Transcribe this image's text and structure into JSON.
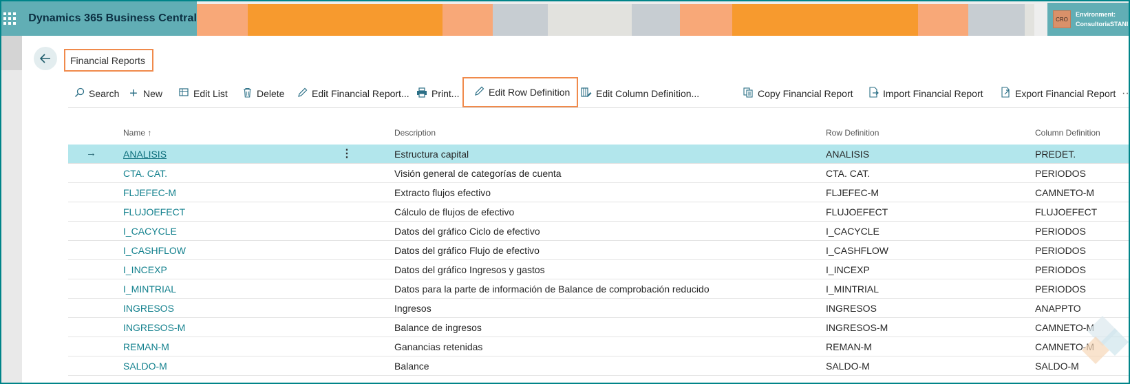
{
  "app": {
    "title": "Dynamics 365 Business Central",
    "environment_label": "Environment:",
    "environment_name": "ConsultoriaSTANI",
    "avatar": "CRO",
    "waffle_icon": "waffle-icon"
  },
  "colors": {
    "brand": "#61aeb5",
    "accent_highlight": "#f08a4b",
    "link": "#12808d",
    "selected_row": "#b2e6ec"
  },
  "page": {
    "title": "Financial Reports",
    "back_icon": "back-arrow-icon"
  },
  "actions": [
    {
      "label": "Search",
      "icon": "search-icon"
    },
    {
      "label": "New",
      "icon": "plus-icon"
    },
    {
      "label": "Edit List",
      "icon": "edit-list-icon"
    },
    {
      "label": "Delete",
      "icon": "trash-icon"
    },
    {
      "label": "Edit Financial Report...",
      "icon": "pencil-icon"
    },
    {
      "label": "Print...",
      "icon": "printer-icon"
    },
    {
      "label": "Edit Row Definition",
      "icon": "pencil-icon"
    },
    {
      "label": "Edit Column Definition...",
      "icon": "column-definition-icon"
    },
    {
      "label": "Copy Financial Report",
      "icon": "copy-icon"
    },
    {
      "label": "Import Financial Report",
      "icon": "import-icon"
    },
    {
      "label": "Export Financial Report",
      "icon": "export-icon"
    }
  ],
  "more_label": "···",
  "table": {
    "headers": {
      "name": "Name",
      "name_sort": "↑",
      "description": "Description",
      "row_definition": "Row Definition",
      "column_definition": "Column Definition"
    },
    "rows": [
      {
        "name": "ANALISIS",
        "description": "Estructura capital",
        "row_definition": "ANALISIS",
        "column_definition": "PREDET."
      },
      {
        "name": "CTA. CAT.",
        "description": "Visión general de categorías de cuenta",
        "row_definition": "CTA. CAT.",
        "column_definition": "PERIODOS"
      },
      {
        "name": "FLJEFEC-M",
        "description": "Extracto flujos efectivo",
        "row_definition": "FLJEFEC-M",
        "column_definition": "CAMNETO-M"
      },
      {
        "name": "FLUJOEFECT",
        "description": "Cálculo de flujos de efectivo",
        "row_definition": "FLUJOEFECT",
        "column_definition": "FLUJOEFECT"
      },
      {
        "name": "I_CACYCLE",
        "description": "Datos del gráfico Ciclo de efectivo",
        "row_definition": "I_CACYCLE",
        "column_definition": "PERIODOS"
      },
      {
        "name": "I_CASHFLOW",
        "description": "Datos del gráfico Flujo de efectivo",
        "row_definition": "I_CASHFLOW",
        "column_definition": "PERIODOS"
      },
      {
        "name": "I_INCEXP",
        "description": "Datos del gráfico Ingresos y gastos",
        "row_definition": "I_INCEXP",
        "column_definition": "PERIODOS"
      },
      {
        "name": "I_MINTRIAL",
        "description": "Datos para la parte de información de Balance de comprobación reducido",
        "row_definition": "I_MINTRIAL",
        "column_definition": "PERIODOS"
      },
      {
        "name": "INGRESOS",
        "description": "Ingresos",
        "row_definition": "INGRESOS",
        "column_definition": "ANAPPTO"
      },
      {
        "name": "INGRESOS-M",
        "description": "Balance de ingresos",
        "row_definition": "INGRESOS-M",
        "column_definition": "CAMNETO-M"
      },
      {
        "name": "REMAN-M",
        "description": "Ganancias retenidas",
        "row_definition": "REMAN-M",
        "column_definition": "CAMNETO-M"
      },
      {
        "name": "SALDO-M",
        "description": "Balance",
        "row_definition": "SALDO-M",
        "column_definition": "SALDO-M"
      }
    ]
  }
}
